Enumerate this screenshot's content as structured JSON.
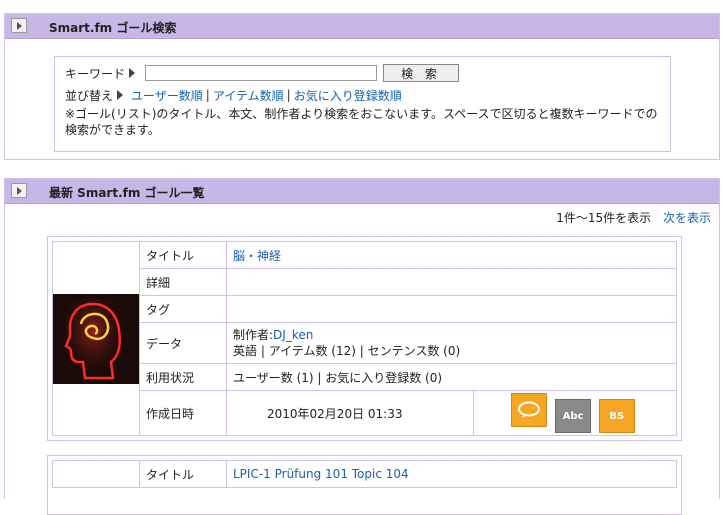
{
  "search_panel": {
    "title": "Smart.fm ゴール検索",
    "keyword_label": "キーワード",
    "keyword_value": "",
    "search_button": "検 索",
    "sort_label": "並び替え",
    "sort_options": [
      "ユーザー数順",
      "アイテム数順",
      "お気に入り登録数順"
    ],
    "note": "※ゴール(リスト)のタイトル、本文、制作者より検索をおこないます。スペースで区切ると複数キーワードでの検索ができます。"
  },
  "list_panel": {
    "title": "最新 Smart.fm ゴール一覧",
    "range_text": "1件〜15件を表示",
    "next_link": "次を表示"
  },
  "labels": {
    "title": "タイトル",
    "detail": "詳細",
    "tags": "タグ",
    "data": "データ",
    "usage": "利用状況",
    "created": "作成日時"
  },
  "goals": [
    {
      "title": "脳・神経",
      "detail": "",
      "tags": "",
      "creator_label": "制作者:",
      "creator": "DJ_ken",
      "data_line": "英語 | アイテム数 (12) | センテンス数 (0)",
      "usage": "ユーザー数 (1) | お気に入り登録数 (0)",
      "created": "2010年02月20日 01:33",
      "icons": [
        "speech-bubble-icon",
        "abc-study-icon",
        "brainspeed-icon"
      ],
      "icon_texts": [
        "",
        "Abc",
        "BS"
      ]
    },
    {
      "title": "LPIC-1 Prüfung 101 Topic 104"
    }
  ],
  "colors": {
    "panel_header": "#c6b7e6",
    "border": "#cfc2e6",
    "link": "#1a5fb4",
    "icon_orange": "#f5a623",
    "icon_gray": "#8a8a8a"
  }
}
